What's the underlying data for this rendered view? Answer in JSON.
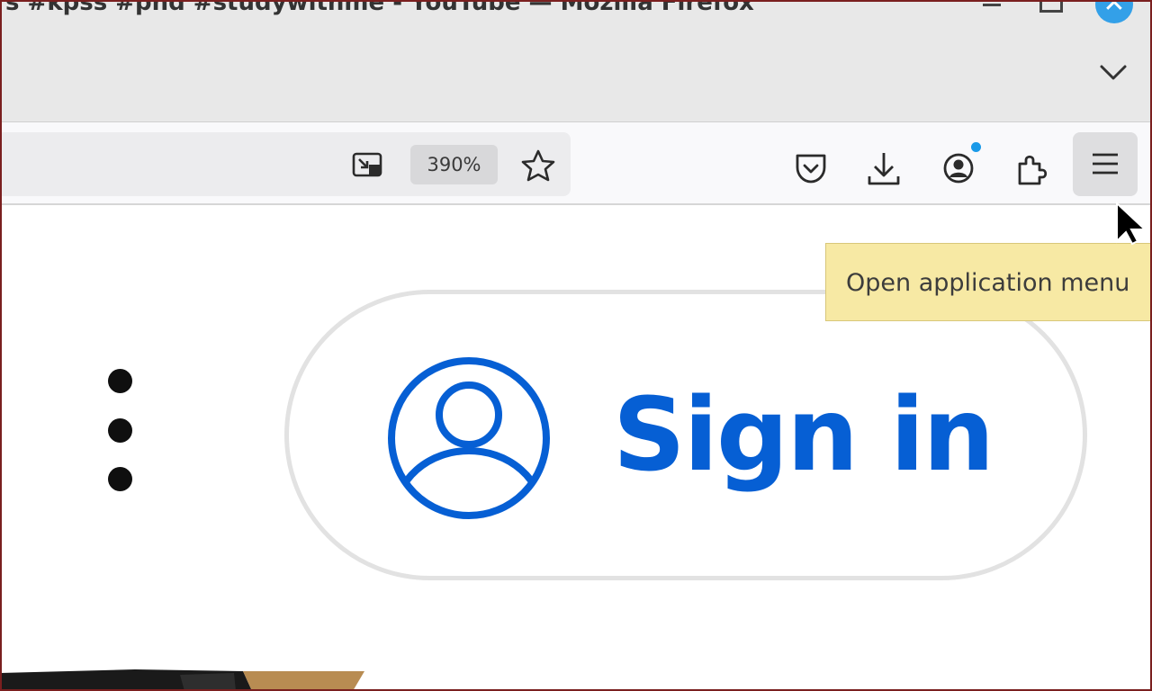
{
  "window": {
    "title": "s #kpss #phd #studywithme - YouTube — Mozilla Firefox",
    "close_glyph": "✕"
  },
  "toolbar": {
    "zoom_level": "390%",
    "icons": [
      "picture-in-picture-icon",
      "bookmark-star-icon",
      "pocket-icon",
      "downloads-icon",
      "account-icon",
      "extensions-icon",
      "hamburger-menu-icon"
    ],
    "notification_dot_color": "#1a9ae8"
  },
  "tooltip": {
    "text": "Open application menu"
  },
  "page": {
    "sign_in_label": "Sign in",
    "accent_color": "#065fd4"
  }
}
